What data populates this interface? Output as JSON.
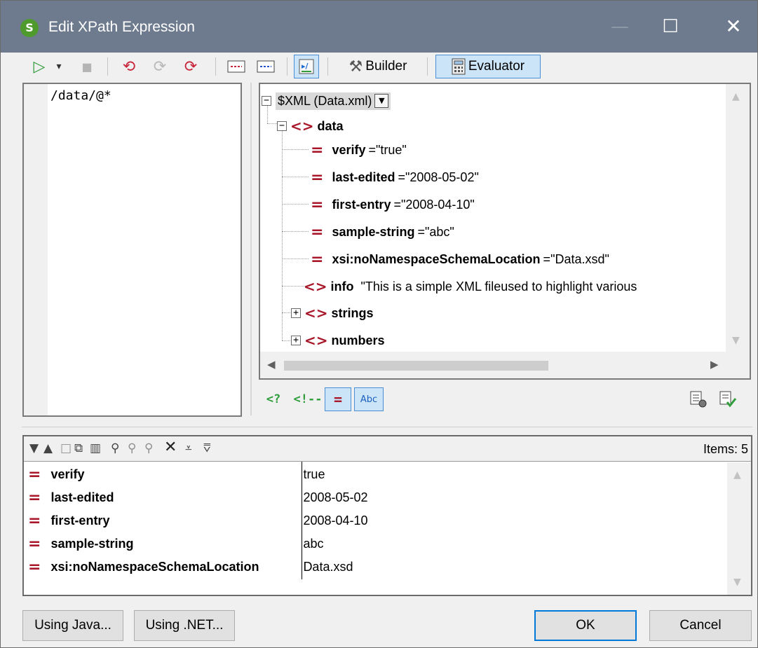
{
  "window": {
    "title": "Edit XPath Expression",
    "app_icon_letter": "S",
    "min_glyph": "—",
    "max_glyph": "☐",
    "close_glyph": "✕"
  },
  "toolbar": {
    "items": [
      {
        "name": "run-icon",
        "glyph": "▷"
      },
      {
        "name": "run-options-dropdown-icon",
        "glyph": "▾"
      },
      {
        "name": "stop-icon",
        "glyph": "■"
      },
      {
        "name": "step-into-icon",
        "glyph": "⟲"
      },
      {
        "name": "step-over-icon",
        "glyph": "⟳"
      },
      {
        "name": "step-out-icon",
        "glyph": "⟳"
      },
      {
        "name": "insert-comment-icon",
        "glyph": "▭"
      },
      {
        "name": "remove-comment-icon",
        "glyph": "▭"
      },
      {
        "name": "xpath-wrap-icon",
        "glyph": "↵"
      },
      {
        "name": "builder-icon",
        "glyph": "⚒"
      },
      {
        "name": "evaluator-icon",
        "glyph": "▦"
      }
    ],
    "builder_label": "Builder",
    "evaluator_label": "Evaluator"
  },
  "xpath": {
    "expression": "/data/@*"
  },
  "tree": {
    "source_label": "$XML (Data.xml)",
    "root_element": "data",
    "attributes": [
      {
        "name": "verify",
        "eq": "=",
        "value": "\"true\""
      },
      {
        "name": "last-edited",
        "eq": "=",
        "value": "\"2008-05-02\""
      },
      {
        "name": "first-entry",
        "eq": "=",
        "value": "\"2008-04-10\""
      },
      {
        "name": "sample-string",
        "eq": "=",
        "value": "\"abc\""
      },
      {
        "name": "xsi:noNamespaceSchemaLocation",
        "eq": "=",
        "value": "\"Data.xsd\""
      }
    ],
    "info_element": "info",
    "info_value": "\"This is a simple XML fileused to highlight various",
    "strings_element": "strings",
    "numbers_element": "numbers",
    "expand_collapsed": "+",
    "expand_expanded": "−",
    "element_glyph": "<>",
    "attribute_glyph": "="
  },
  "filters": {
    "processing_instruction": "<?",
    "comment": "<!--",
    "attribute": "=",
    "text": "Abc"
  },
  "results": {
    "items_label": "Items: 5",
    "toolbar_icons": [
      "▼",
      "▲",
      "□",
      "⧉",
      "▥",
      "⚲",
      "⚲",
      "⚲",
      "✕",
      "⩡",
      "⩢"
    ],
    "rows": [
      {
        "name": "verify",
        "value": "true"
      },
      {
        "name": "last-edited",
        "value": "2008-05-02"
      },
      {
        "name": "first-entry",
        "value": "2008-04-10"
      },
      {
        "name": "sample-string",
        "value": "abc"
      },
      {
        "name": "xsi:noNamespaceSchemaLocation",
        "value": "Data.xsd"
      }
    ]
  },
  "buttons": {
    "using_java": "Using Java...",
    "using_net": "Using .NET...",
    "ok": "OK",
    "cancel": "Cancel"
  },
  "colors": {
    "titlebar": "#6e7b8e",
    "xml_red": "#a8182a",
    "green": "#2e9d3a",
    "pressed_bg": "#cce4f7",
    "pressed_border": "#4a8ed8"
  }
}
